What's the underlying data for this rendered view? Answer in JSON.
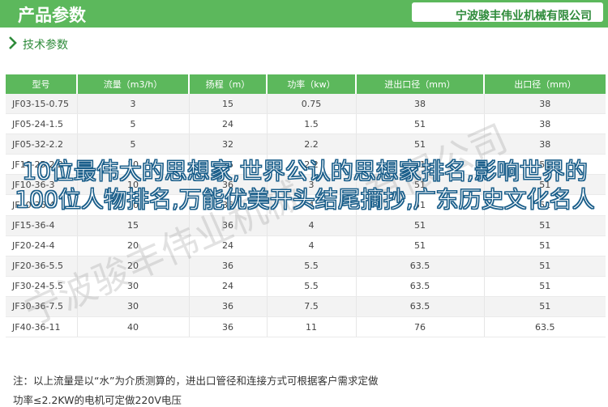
{
  "header": {
    "title": "产品参数",
    "brand": "宁波骏丰伟业机械有限公司"
  },
  "section": {
    "title": "技术参数"
  },
  "table": {
    "columns": [
      "型号",
      "流量（m3/h）",
      "扬程（m）",
      "功率（kw）",
      "进出口径（mm）",
      "出口径（mm）"
    ],
    "rows": [
      [
        "JF03-15-0.75",
        "3",
        "15",
        "0.75",
        "38",
        "38"
      ],
      [
        "JF05-24-1.5",
        "5",
        "24",
        "1.5",
        "51",
        "38"
      ],
      [
        "JF05-32-2.2",
        "5",
        "32",
        "2.2",
        "51",
        "38"
      ],
      [
        "JF10-25-2.2",
        "10",
        "25",
        "2.2",
        "51",
        "51"
      ],
      [
        "JF10-36-3",
        "10",
        "36",
        "3",
        "51",
        "51"
      ],
      [
        "JF10-36-4",
        "10",
        "36",
        "4",
        "51",
        "51"
      ],
      [
        "JF15-36-4",
        "15",
        "36",
        "4",
        "51",
        "51"
      ],
      [
        "JF20-24-4",
        "20",
        "24",
        "4",
        "51",
        "51"
      ],
      [
        "JF20-36-5.5",
        "20",
        "36",
        "5.5",
        "63.5",
        "51"
      ],
      [
        "JF30-24-5.5",
        "30",
        "24",
        "5.5",
        "63.5",
        "51"
      ],
      [
        "JF30-36-7.5",
        "30",
        "36",
        "7.5",
        "63.5",
        "51"
      ],
      [
        "JF40-36-11",
        "40",
        "36",
        "11",
        "76",
        "63.5"
      ]
    ]
  },
  "notes": {
    "line1": "注：以上流量是以“水”为介质测算的，进出口管径和连接方式可根据客户需求定做",
    "line2": "功率≤2.2KW的电机可定做220V电压"
  },
  "overlay": {
    "text": "10位最伟大的思想家,世界公认的思想家排名,影响世界的100位人物排名,万能优美开头结尾摘抄,广东历史文化名人"
  },
  "watermark": {
    "text1": "宁波骏丰伟业机械",
    "text2": "有限公司"
  },
  "colors": {
    "brand_green": "#5cb85c",
    "dark_green": "#2e8b3a"
  }
}
